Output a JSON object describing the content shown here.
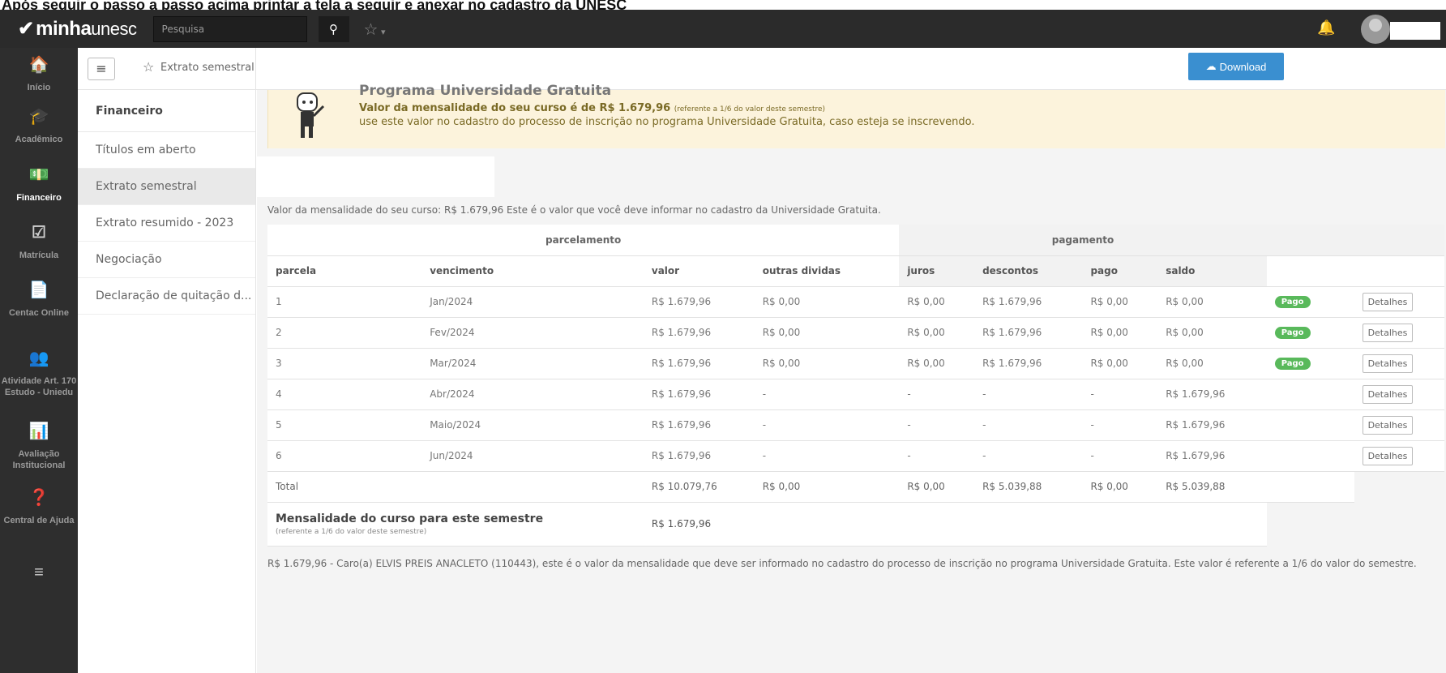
{
  "caption": "Após seguir o passo a passo acima printar a tela a seguir e anexar no cadastro da UNESC",
  "topbar": {
    "logo_bold": "minha",
    "logo_rest": "unesc",
    "search_placeholder": "Pesquisa"
  },
  "leftnav": [
    {
      "label": "Início",
      "icon": "home-icon",
      "glyph": "🏠"
    },
    {
      "label": "Acadêmico",
      "icon": "graduation-cap-icon",
      "glyph": "🎓"
    },
    {
      "label": "Financeiro",
      "icon": "money-icon",
      "glyph": "💵",
      "active": true
    },
    {
      "label": "Matrícula",
      "icon": "check-square-icon",
      "glyph": "☑"
    },
    {
      "label": "Centac Online",
      "icon": "file-icon",
      "glyph": "📄"
    },
    {
      "label": "Atividade Art. 170 Estudo - Uniedu",
      "icon": "users-icon",
      "glyph": "👥"
    },
    {
      "label": "Avaliação Institucional",
      "icon": "bar-chart-icon",
      "glyph": "📊"
    },
    {
      "label": "Central de Ajuda",
      "icon": "question-icon",
      "glyph": "❓"
    },
    {
      "label": "",
      "icon": "menu-icon",
      "glyph": "≡"
    }
  ],
  "submenu": {
    "title": "Financeiro",
    "items": [
      {
        "label": "Títulos em aberto"
      },
      {
        "label": "Extrato semestral",
        "active": true
      },
      {
        "label": "Extrato resumido - 2023"
      },
      {
        "label": "Negociação"
      },
      {
        "label": "Declaração de quitação d..."
      }
    ]
  },
  "breadcrumb": {
    "label": "Extrato semestral"
  },
  "download_label": "Download",
  "banner": {
    "title": "Programa Universidade Gratuita",
    "line1": "Valor da mensalidade do seu curso é de R$ 1.679,96",
    "line1_small": "(referente a 1/6 do valor deste semestre)",
    "line2": "use este valor no cadastro do processo de inscrição no programa Universidade Gratuita, caso esteja se inscrevendo."
  },
  "info_line": "Valor da mensalidade do seu curso: R$ 1.679,96 Este é o valor que você deve informar no cadastro da Universidade Gratuita.",
  "table": {
    "group_parcelamento": "parcelamento",
    "group_pagamento": "pagamento",
    "headers": [
      "parcela",
      "vencimento",
      "valor",
      "outras dividas",
      "juros",
      "descontos",
      "pago",
      "saldo"
    ],
    "rows": [
      {
        "parcela": "1",
        "vencimento": "Jan/2024",
        "valor": "R$ 1.679,96",
        "outras": "R$ 0,00",
        "juros": "R$ 0,00",
        "descontos": "R$ 1.679,96",
        "pago": "R$ 0,00",
        "saldo": "R$ 0,00",
        "status": "Pago",
        "btn": "Detalhes"
      },
      {
        "parcela": "2",
        "vencimento": "Fev/2024",
        "valor": "R$ 1.679,96",
        "outras": "R$ 0,00",
        "juros": "R$ 0,00",
        "descontos": "R$ 1.679,96",
        "pago": "R$ 0,00",
        "saldo": "R$ 0,00",
        "status": "Pago",
        "btn": "Detalhes"
      },
      {
        "parcela": "3",
        "vencimento": "Mar/2024",
        "valor": "R$ 1.679,96",
        "outras": "R$ 0,00",
        "juros": "R$ 0,00",
        "descontos": "R$ 1.679,96",
        "pago": "R$ 0,00",
        "saldo": "R$ 0,00",
        "status": "Pago",
        "btn": "Detalhes"
      },
      {
        "parcela": "4",
        "vencimento": "Abr/2024",
        "valor": "R$ 1.679,96",
        "outras": "-",
        "juros": "-",
        "descontos": "-",
        "pago": "-",
        "saldo": "R$ 1.679,96",
        "status": "",
        "btn": "Detalhes"
      },
      {
        "parcela": "5",
        "vencimento": "Maio/2024",
        "valor": "R$ 1.679,96",
        "outras": "-",
        "juros": "-",
        "descontos": "-",
        "pago": "-",
        "saldo": "R$ 1.679,96",
        "status": "",
        "btn": "Detalhes"
      },
      {
        "parcela": "6",
        "vencimento": "Jun/2024",
        "valor": "R$ 1.679,96",
        "outras": "-",
        "juros": "-",
        "descontos": "-",
        "pago": "-",
        "saldo": "R$ 1.679,96",
        "status": "",
        "btn": "Detalhes"
      }
    ],
    "total": {
      "label": "Total",
      "valor": "R$ 10.079,76",
      "outras": "R$ 0,00",
      "juros": "R$ 0,00",
      "descontos": "R$ 5.039,88",
      "pago": "R$ 0,00",
      "saldo": "R$ 5.039,88"
    },
    "mensalidade": {
      "label": "Mensalidade do curso para este semestre",
      "sub": "(referente a 1/6 do valor deste semestre)",
      "valor": "R$ 1.679,96"
    }
  },
  "footer": "R$ 1.679,96 - Caro(a) ELVIS PREIS ANACLETO (110443), este é o valor da mensalidade que deve ser informado no cadastro do processo de inscrição no programa Universidade Gratuita. Este valor é referente a 1/6 do valor do semestre.",
  "colors": {
    "badge_green": "#59b95b",
    "download_blue": "#3a8fd0",
    "banner_bg": "#fcf3dc"
  }
}
